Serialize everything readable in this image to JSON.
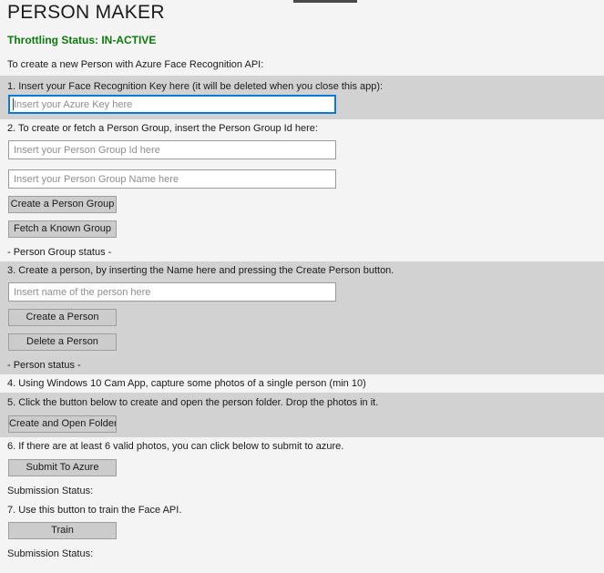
{
  "app": {
    "title": "PERSON MAKER",
    "throttling_status": "Throttling Status: IN-ACTIVE",
    "throttling_color": "#0d7a0d",
    "intro": "To create a new Person with Azure Face Recognition API:"
  },
  "steps": {
    "step1_label": "1. Insert your Face Recognition Key here (it will be deleted when you close this app):",
    "step2_label": "2. To create or fetch a Person Group, insert the Person Group Id here:",
    "step3_label": "3. Create a person, by inserting the Name here and pressing the Create Person button.",
    "step4_label": "4. Using Windows 10 Cam App, capture some photos of a single person (min 10)",
    "step5_label": "5. Click the button below to create and open the person folder. Drop the photos in it.",
    "step6_label": "6. If there are at least 6 valid photos, you can click below to submit to azure.",
    "step7_label": "7. Use this button to train the Face API."
  },
  "inputs": {
    "azure_key": {
      "value": "",
      "placeholder": "Insert your Azure Key here",
      "focused": true
    },
    "person_group_id": {
      "value": "",
      "placeholder": "Insert your Person Group Id here",
      "focused": false
    },
    "person_group_name": {
      "value": "",
      "placeholder": "Insert your Person Group Name here",
      "focused": false
    },
    "person_name": {
      "value": "",
      "placeholder": "Insert name of the person here",
      "focused": false
    }
  },
  "buttons": {
    "create_person_group": "Create a Person Group",
    "fetch_known_group": "Fetch a Known Group",
    "create_person": "Create a Person",
    "delete_person": "Delete a Person",
    "create_and_open_folder": "Create and Open Folder",
    "submit_to_azure": "Submit To Azure",
    "train": "Train"
  },
  "status": {
    "person_group_status": "- Person Group status -",
    "person_status": "- Person status -",
    "submission_status_1": "Submission Status:",
    "submission_status_2": "Submission Status:"
  },
  "colors": {
    "page_background": "#f4f4f4",
    "band_background": "#d2d2d2",
    "button_face": "#cccccc",
    "button_border": "#9e9e9e",
    "input_border": "#9a9a9a",
    "focus_border": "#0a7ad8",
    "text": "#1a1a1a",
    "placeholder": "#8e8e8e"
  }
}
